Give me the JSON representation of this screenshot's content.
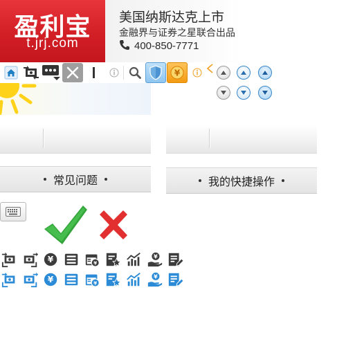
{
  "banner": {
    "logo_title": "盈利宝",
    "logo_url": "t.jrj.com",
    "info_title": "美国纳斯达克上市",
    "info_subtitle": "金融界与证券之星联合出品",
    "phone": "400-850-7771"
  },
  "toolbar": {
    "icons": [
      "home-icon",
      "money-transfer-icon",
      "chat-more-icon",
      "close-icon",
      "text-cursor-icon",
      "info-icon",
      "search-icon",
      "shield-icon",
      "yen-coin-icon",
      "info-icon",
      "chevron-left-icon"
    ],
    "arrow_buttons": [
      "arrow-up-grey",
      "arrow-up-blue",
      "arrow-up-blue-active",
      "arrow-down-grey",
      "arrow-down-blue",
      "arrow-down-blue-active"
    ]
  },
  "panels": {
    "faq_label": "常见问题",
    "shortcuts_label": "我的快捷操作"
  },
  "status": {
    "check": "check-icon",
    "cross": "cross-icon"
  },
  "quick_actions": {
    "icons": [
      "transfer-in",
      "transfer-out",
      "yen",
      "ledger",
      "calendar-yen",
      "favorite-doc",
      "trend-chart",
      "yen-hand",
      "edit-doc"
    ]
  },
  "colors": {
    "brand_red": "#d42028",
    "icon_grey": "#3c3c3c",
    "icon_blue": "#2b8bd6",
    "check_green": "#3aa63f",
    "cross_red": "#e02a2a"
  }
}
